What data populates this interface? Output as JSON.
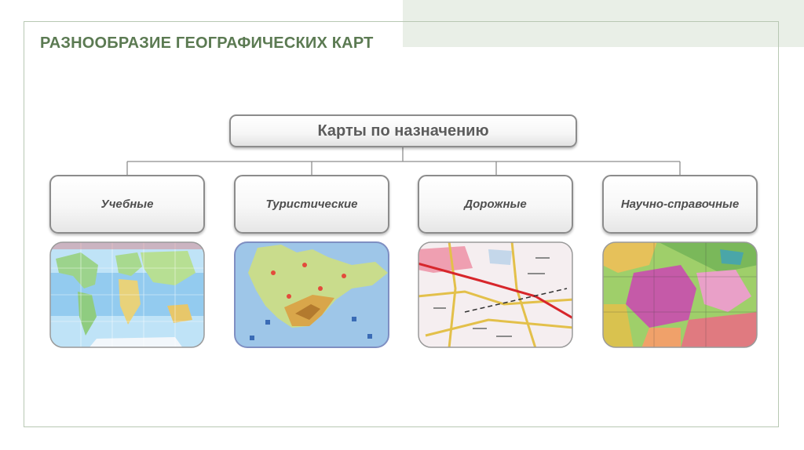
{
  "slide": {
    "title": "РАЗНООБРАЗИЕ  ГЕОГРАФИЧЕСКИХ КАРТ"
  },
  "diagram": {
    "root": "Карты по назначению",
    "categories": [
      {
        "label": "Учебные",
        "map": "physical-world-map"
      },
      {
        "label": "Туристические",
        "map": "crimea-tourist-map"
      },
      {
        "label": "Дорожные",
        "map": "road-map"
      },
      {
        "label": "Научно-справочные",
        "map": "geological-map"
      }
    ]
  }
}
